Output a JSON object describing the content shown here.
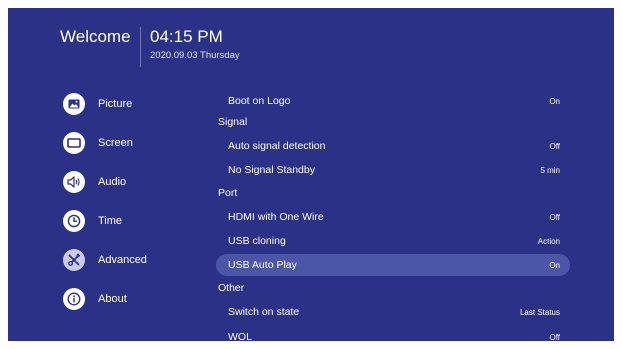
{
  "header": {
    "welcome": "Welcome",
    "time": "04:15 PM",
    "date": "2020.09.03 Thursday"
  },
  "sidebar": {
    "items": [
      {
        "label": "Picture",
        "icon": "picture-icon"
      },
      {
        "label": "Screen",
        "icon": "screen-icon"
      },
      {
        "label": "Audio",
        "icon": "audio-icon"
      },
      {
        "label": "Time",
        "icon": "clock-icon"
      },
      {
        "label": "Advanced",
        "icon": "tools-icon",
        "active": true
      },
      {
        "label": "About",
        "icon": "info-icon"
      }
    ]
  },
  "settings": {
    "boot_on_logo": {
      "label": "Boot on Logo",
      "value": "On"
    },
    "section_signal": "Signal",
    "auto_signal_detection": {
      "label": "Auto signal detection",
      "value": "Off"
    },
    "no_signal_standby": {
      "label": "No Signal Standby",
      "value": "5 min"
    },
    "section_port": "Port",
    "hdmi_one_wire": {
      "label": "HDMI with One Wire",
      "value": "Off"
    },
    "usb_cloning": {
      "label": "USB cloning",
      "value": "Action"
    },
    "usb_auto_play": {
      "label": "USB Auto Play",
      "value": "On",
      "selected": true
    },
    "section_other": "Other",
    "switch_on_state": {
      "label": "Switch on state",
      "value": "Last Status"
    },
    "wol": {
      "label": "WOL",
      "value": "Off"
    }
  },
  "colors": {
    "background": "#2a3187",
    "selected_row": "#4b57a6",
    "text": "#ffffff"
  }
}
